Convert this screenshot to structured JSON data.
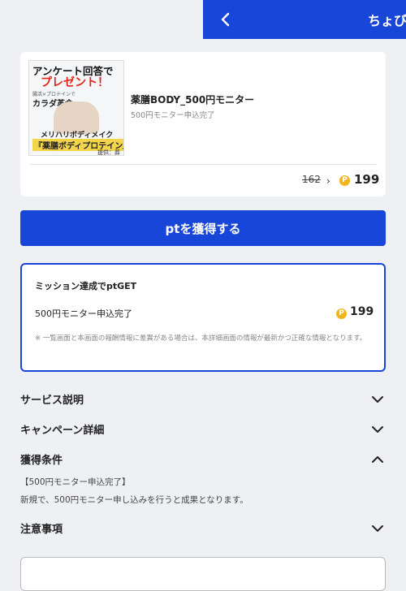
{
  "header": {
    "title": "ちょび",
    "back_icon": "chevron-left-icon"
  },
  "offer": {
    "banner": {
      "line1": "アンケート回答で",
      "line2": "プレゼント！",
      "line3": "腸活×プロテインで",
      "line4": "カラダ革命",
      "line5": "メリハリボディメイク",
      "line6": "『薬膳ボディプロテイン』",
      "credit": "提供：葬"
    },
    "name": "薬膳BODY_500円モニター",
    "subtitle": "500円モニター申込完了",
    "old_points": "162",
    "points": "199",
    "coin_symbol": "P"
  },
  "cta": {
    "label": "ptを獲得する"
  },
  "mission": {
    "title": "ミッション達成でptGET",
    "item": "500円モニター申込完了",
    "points": "199",
    "coin_symbol": "P",
    "note": "※ 一覧画面と本画面の報酬情報に差異がある場合は、本詳細画面の情報が最新かつ正確な情報となります。"
  },
  "sections": {
    "service": "サービス説明",
    "campaign": "キャンペーン詳細",
    "conditions": "獲得条件",
    "notes": "注意事項"
  },
  "conditions": {
    "line1": "【500円モニター申込完了】",
    "line2": "新規で、500円モニター申し込みを行うと成果となります。"
  },
  "colors": {
    "primary": "#1846d8",
    "coin": "#f2b51d",
    "background": "#eef0f4"
  }
}
